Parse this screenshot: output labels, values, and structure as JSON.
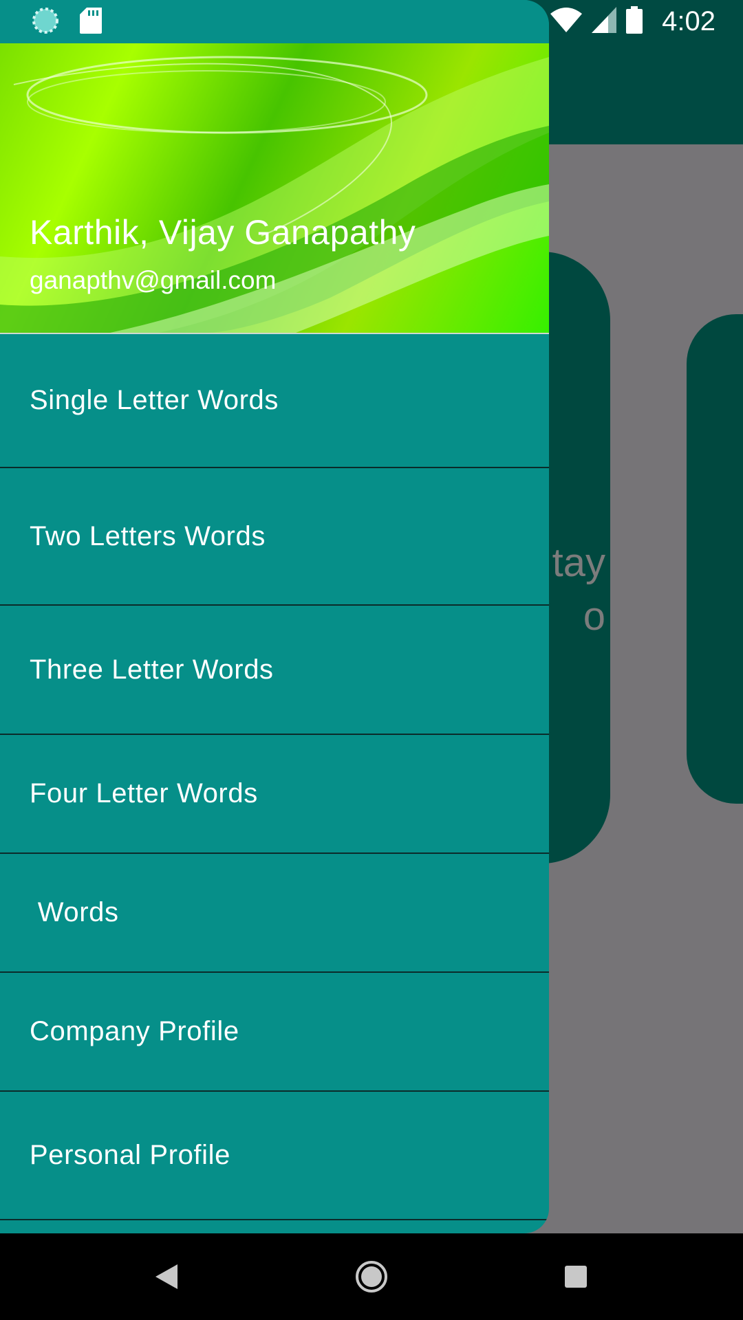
{
  "status_bar": {
    "time": "4:02",
    "icons": [
      "sync-icon",
      "sd-card-icon",
      "wifi-icon",
      "signal-icon",
      "battery-icon"
    ]
  },
  "background": {
    "partial_text_line1": "tay",
    "partial_text_line2": "o"
  },
  "drawer": {
    "header": {
      "name": "Karthik, Vijay Ganapathy",
      "email": "ganapthv@gmail.com"
    },
    "items": [
      {
        "label": "Single Letter Words"
      },
      {
        "label": "Two Letters Words"
      },
      {
        "label": "Three Letter Words"
      },
      {
        "label": "Four Letter Words"
      },
      {
        "label": " Words"
      },
      {
        "label": "Company Profile"
      },
      {
        "label": "Personal Profile"
      }
    ]
  },
  "nav_bar": {
    "buttons": [
      "back-icon",
      "home-icon",
      "recents-icon"
    ]
  },
  "colors": {
    "drawer_bg": "#068f89",
    "app_bar": "#004a42",
    "scrim": "#767477",
    "divider": "#0b2b2a"
  }
}
